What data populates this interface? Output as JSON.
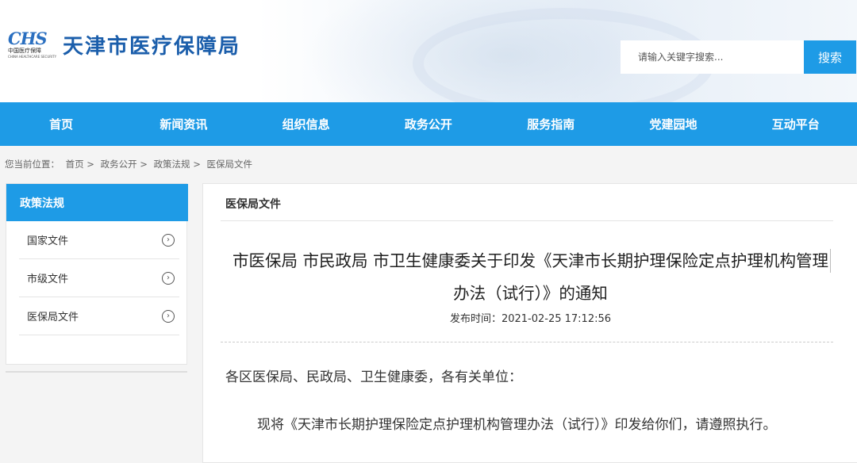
{
  "header": {
    "logo_text": "CHS",
    "logo_cn": "中国医疗保障",
    "logo_en": "CHINA HEALTHCARE SECURITY",
    "site_title": "天津市医疗保障局",
    "search_placeholder": "请输入关键字搜索...",
    "search_button": "搜索"
  },
  "nav": {
    "items": [
      "首页",
      "新闻资讯",
      "组织信息",
      "政务公开",
      "服务指南",
      "党建园地",
      "互动平台"
    ]
  },
  "breadcrumb": {
    "prefix": "您当前位置：",
    "items": [
      "首页 >",
      "政务公开 >",
      "政策法规 >",
      "医保局文件"
    ]
  },
  "sidebar": {
    "title": "政策法规",
    "items": [
      "国家文件",
      "市级文件",
      "医保局文件"
    ],
    "arrow_glyph": "›"
  },
  "content": {
    "section_title": "医保局文件",
    "article_title": "市医保局 市民政局 市卫生健康委关于印发《天津市长期护理保险定点护理机构管理办法（试行）》的通知",
    "publish_label": "发布时间：2021-02-25 17:12:56",
    "para1": "各区医保局、民政局、卫生健康委，各有关单位：",
    "para2": "现将《天津市长期护理保险定点护理机构管理办法（试行）》印发给你们，请遵照执行。"
  },
  "colors": {
    "primary": "#1e9be6",
    "title_blue": "#1b5eab"
  }
}
